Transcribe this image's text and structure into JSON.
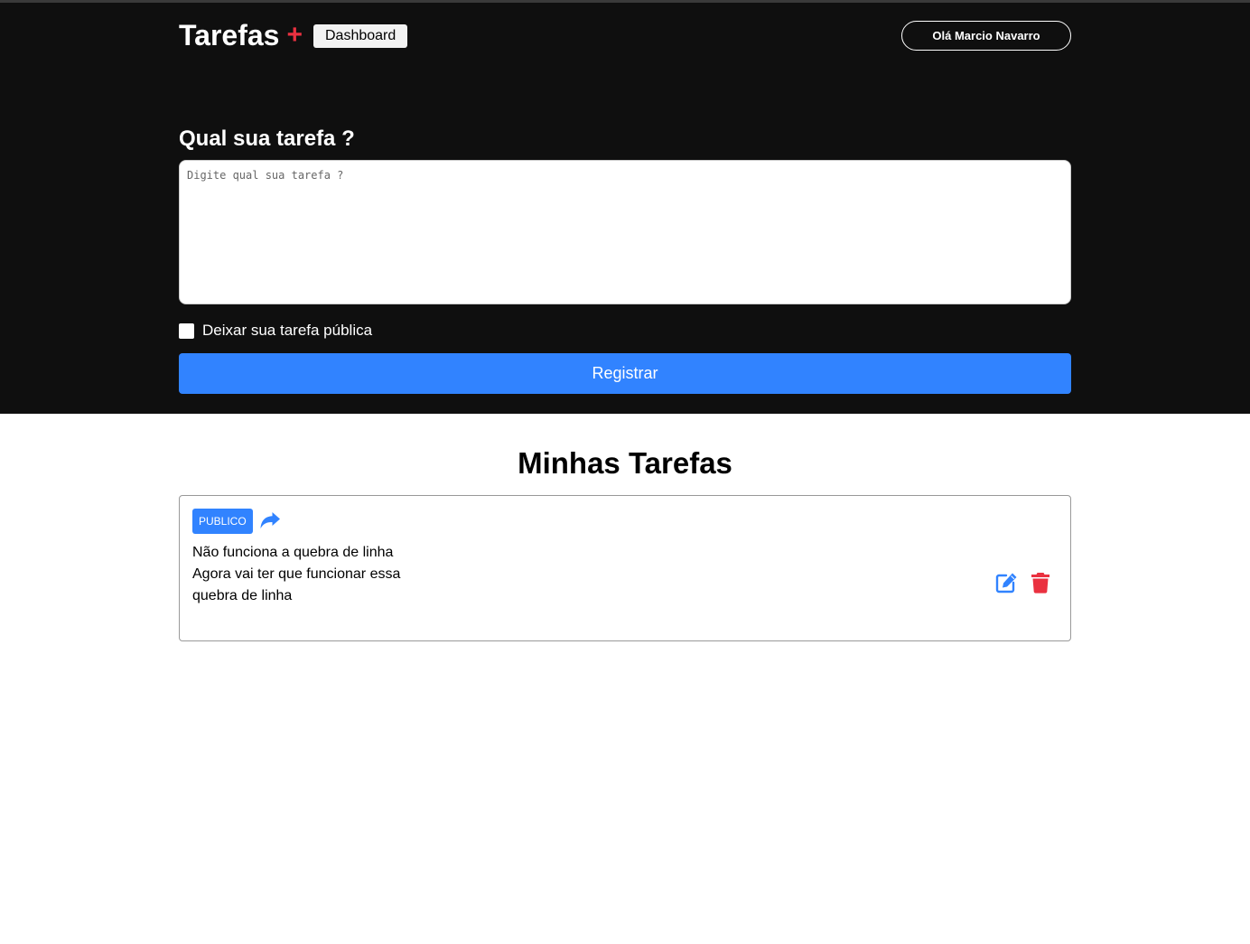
{
  "header": {
    "brand_title": "Tarefas",
    "brand_plus": "+",
    "dashboard_label": "Dashboard",
    "user_label": "Olá Marcio Navarro"
  },
  "form": {
    "title": "Qual sua tarefa ?",
    "textarea_placeholder": "Digite qual sua tarefa ?",
    "textarea_value": "",
    "checkbox_label": "Deixar sua tarefa pública",
    "checkbox_checked": false,
    "submit_label": "Registrar"
  },
  "tasks": {
    "title": "Minhas Tarefas",
    "items": [
      {
        "badge": "PUBLICO",
        "text": "Não funciona a quebra de linha\nAgora vai ter que funcionar essa\nquebra de linha",
        "icons": [
          "share-icon",
          "edit-icon",
          "trash-icon"
        ]
      }
    ]
  },
  "colors": {
    "dark_bg": "#0f0f0f",
    "accent_blue": "#3183ff",
    "accent_red": "#ea3140"
  }
}
